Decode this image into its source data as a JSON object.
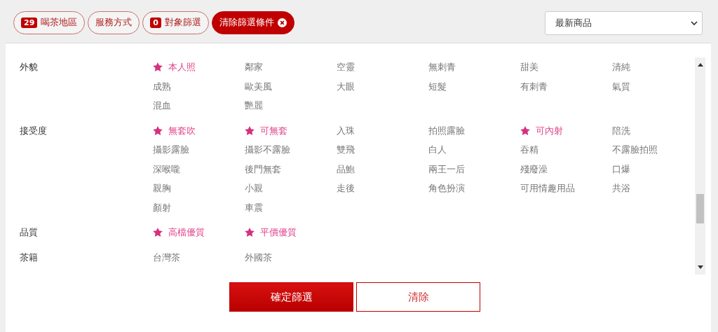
{
  "filter_pills": [
    {
      "label": "喝茶地區",
      "count": "29",
      "kind": "outline"
    },
    {
      "label": "服務方式",
      "kind": "outline"
    },
    {
      "label": "對象篩選",
      "count": "0",
      "kind": "outline"
    },
    {
      "label": "清除篩選條件",
      "kind": "clear"
    }
  ],
  "sort_select": {
    "value": "最新商品"
  },
  "groups": [
    {
      "label": "外貌",
      "options": [
        {
          "label": "本人照",
          "starred": true
        },
        {
          "label": "鄰家",
          "starred": false
        },
        {
          "label": "空靈",
          "starred": false
        },
        {
          "label": "無刺青",
          "starred": false
        },
        {
          "label": "甜美",
          "starred": false
        },
        {
          "label": "清純",
          "starred": false
        },
        {
          "label": "成熟",
          "starred": false
        },
        {
          "label": "歐美風",
          "starred": false
        },
        {
          "label": "大眼",
          "starred": false
        },
        {
          "label": "短髮",
          "starred": false
        },
        {
          "label": "有刺青",
          "starred": false
        },
        {
          "label": "氣質",
          "starred": false
        },
        {
          "label": "混血",
          "starred": false
        },
        {
          "label": "艷麗",
          "starred": false
        }
      ]
    },
    {
      "label": "接受度",
      "options": [
        {
          "label": "無套吹",
          "starred": true
        },
        {
          "label": "可無套",
          "starred": true
        },
        {
          "label": "入珠",
          "starred": false
        },
        {
          "label": "拍照露臉",
          "starred": false
        },
        {
          "label": "可內射",
          "starred": true
        },
        {
          "label": "陪洗",
          "starred": false
        },
        {
          "label": "攝影露臉",
          "starred": false
        },
        {
          "label": "攝影不露臉",
          "starred": false
        },
        {
          "label": "雙飛",
          "starred": false
        },
        {
          "label": "白人",
          "starred": false
        },
        {
          "label": "吞精",
          "starred": false
        },
        {
          "label": "不露臉拍照",
          "starred": false
        },
        {
          "label": "深喉嚨",
          "starred": false
        },
        {
          "label": "後門無套",
          "starred": false
        },
        {
          "label": "品鮑",
          "starred": false
        },
        {
          "label": "兩王一后",
          "starred": false
        },
        {
          "label": "殘廢澡",
          "starred": false
        },
        {
          "label": "口爆",
          "starred": false
        },
        {
          "label": "親胸",
          "starred": false
        },
        {
          "label": "小親",
          "starred": false
        },
        {
          "label": "走後",
          "starred": false
        },
        {
          "label": "角色扮演",
          "starred": false
        },
        {
          "label": "可用情趣用品",
          "starred": false
        },
        {
          "label": "共浴",
          "starred": false
        },
        {
          "label": "顏射",
          "starred": false
        },
        {
          "label": "車震",
          "starred": false
        }
      ]
    },
    {
      "label": "品質",
      "options": [
        {
          "label": "高檔優質",
          "starred": true
        },
        {
          "label": "平價優質",
          "starred": true
        }
      ]
    },
    {
      "label": "茶籍",
      "options": [
        {
          "label": "台灣茶",
          "starred": false
        },
        {
          "label": "外國茶",
          "starred": false
        }
      ]
    }
  ],
  "buttons": [
    {
      "label": "確定篩選",
      "kind": "primary"
    },
    {
      "label": "清除",
      "kind": "secondary"
    }
  ]
}
